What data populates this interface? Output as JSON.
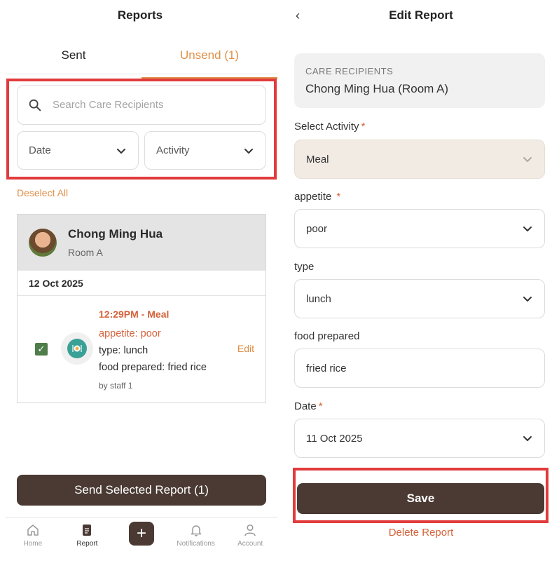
{
  "left": {
    "title": "Reports",
    "tabs": {
      "sent": "Sent",
      "unsend": "Unsend (1)"
    },
    "search": {
      "placeholder": "Search Care Recipients"
    },
    "filters": {
      "date": "Date",
      "activity": "Activity"
    },
    "deselect_all": "Deselect All",
    "card": {
      "name": "Chong Ming Hua",
      "room": "Room A",
      "date": "12 Oct 2025",
      "entry": {
        "time": "12:29PM - Meal",
        "appetite": "appetite: poor",
        "type": "type: lunch",
        "food": "food prepared: fried rice",
        "by": "by staff 1",
        "edit": "Edit",
        "checked": true
      }
    },
    "send_button": "Send Selected Report (1)",
    "nav": {
      "home": "Home",
      "report": "Report",
      "add": "+",
      "notifications": "Notifications",
      "account": "Account"
    }
  },
  "right": {
    "back": "‹",
    "title": "Edit Report",
    "recipient_label": "CARE RECIPIENTS",
    "recipient_value": "Chong Ming Hua (Room A)",
    "fields": {
      "activity": {
        "label": "Select Activity",
        "required": "*",
        "value": "Meal"
      },
      "appetite": {
        "label": "appetite",
        "required": "*",
        "value": "poor"
      },
      "type": {
        "label": "type",
        "value": "lunch"
      },
      "food": {
        "label": "food prepared",
        "value": "fried rice"
      },
      "date": {
        "label": "Date",
        "required": "*",
        "value": "11 Oct 2025"
      }
    },
    "save": "Save",
    "delete": "Delete Report"
  },
  "colors": {
    "accent": "#e0904a",
    "primary": "#4a3a33",
    "highlight": "#e23b3b",
    "danger": "#d4623a"
  }
}
